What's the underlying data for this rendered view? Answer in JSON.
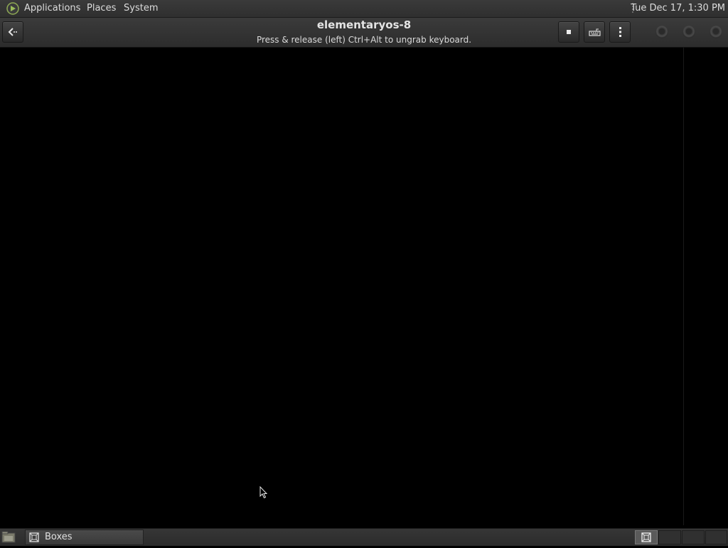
{
  "top_panel": {
    "menus": [
      {
        "label": "Applications"
      },
      {
        "label": "Places"
      },
      {
        "label": "System"
      }
    ],
    "clock": "Tue Dec 17,  1:30 PM"
  },
  "headerbar": {
    "title": "elementaryos-8",
    "subtitle": "Press & release (left) Ctrl+Alt to ungrab keyboard.",
    "buttons": {
      "back": "back-arrow-icon",
      "stop": "stop-square-icon",
      "keyboard": "keyboard-icon",
      "menu": "vertical-dots-icon"
    }
  },
  "taskbar": {
    "task_label": "Boxes",
    "workspaces": [
      1,
      2,
      3,
      4
    ],
    "active_workspace": 1
  },
  "colors": {
    "panel_bg": "#333333",
    "display_bg": "#000000",
    "text": "#dcdcdc"
  }
}
